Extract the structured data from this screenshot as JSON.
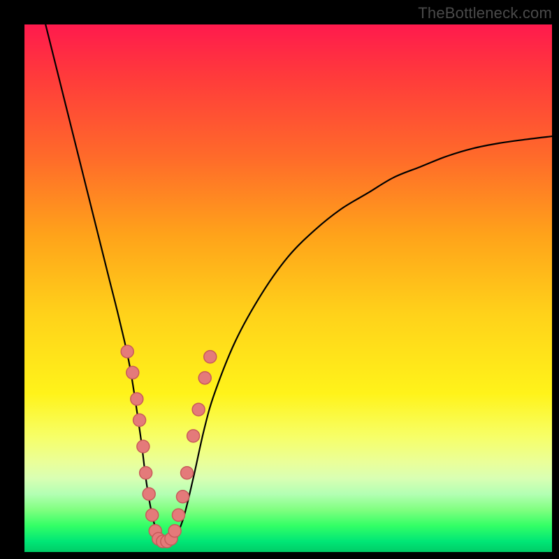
{
  "watermark": "TheBottleneck.com",
  "colors": {
    "frame": "#000000",
    "curve": "#000000",
    "dot_fill": "#e47a7a",
    "dot_stroke": "#c85a5a"
  },
  "chart_data": {
    "type": "line",
    "title": "",
    "xlabel": "",
    "ylabel": "",
    "xlim": [
      0,
      100
    ],
    "ylim": [
      0,
      100
    ],
    "grid": false,
    "legend": false,
    "annotations": [
      "TheBottleneck.com"
    ],
    "series": [
      {
        "name": "bottleneck-curve",
        "x": [
          4,
          6,
          8,
          10,
          12,
          14,
          16,
          18,
          20,
          22,
          23,
          24,
          25,
          26,
          28,
          30,
          32,
          34,
          36,
          40,
          45,
          50,
          55,
          60,
          65,
          70,
          75,
          80,
          85,
          90,
          95,
          100
        ],
        "y": [
          100,
          92,
          84,
          76,
          68,
          60,
          52,
          44,
          35,
          22,
          14,
          8,
          4,
          2,
          2,
          6,
          14,
          23,
          30,
          40,
          49,
          56,
          61,
          65,
          68,
          71,
          73,
          75,
          76.5,
          77.5,
          78.2,
          78.8
        ]
      }
    ],
    "markers": [
      {
        "x": 19.5,
        "y": 38
      },
      {
        "x": 20.5,
        "y": 34
      },
      {
        "x": 21.3,
        "y": 29
      },
      {
        "x": 21.8,
        "y": 25
      },
      {
        "x": 22.5,
        "y": 20
      },
      {
        "x": 23.0,
        "y": 15
      },
      {
        "x": 23.6,
        "y": 11
      },
      {
        "x": 24.2,
        "y": 7
      },
      {
        "x": 24.8,
        "y": 4
      },
      {
        "x": 25.4,
        "y": 2.5
      },
      {
        "x": 26.2,
        "y": 2
      },
      {
        "x": 27.0,
        "y": 2
      },
      {
        "x": 27.8,
        "y": 2.5
      },
      {
        "x": 28.5,
        "y": 4
      },
      {
        "x": 29.2,
        "y": 7
      },
      {
        "x": 30.0,
        "y": 10.5
      },
      {
        "x": 30.8,
        "y": 15
      },
      {
        "x": 32.0,
        "y": 22
      },
      {
        "x": 33.0,
        "y": 27
      },
      {
        "x": 34.2,
        "y": 33
      },
      {
        "x": 35.2,
        "y": 37
      }
    ]
  }
}
